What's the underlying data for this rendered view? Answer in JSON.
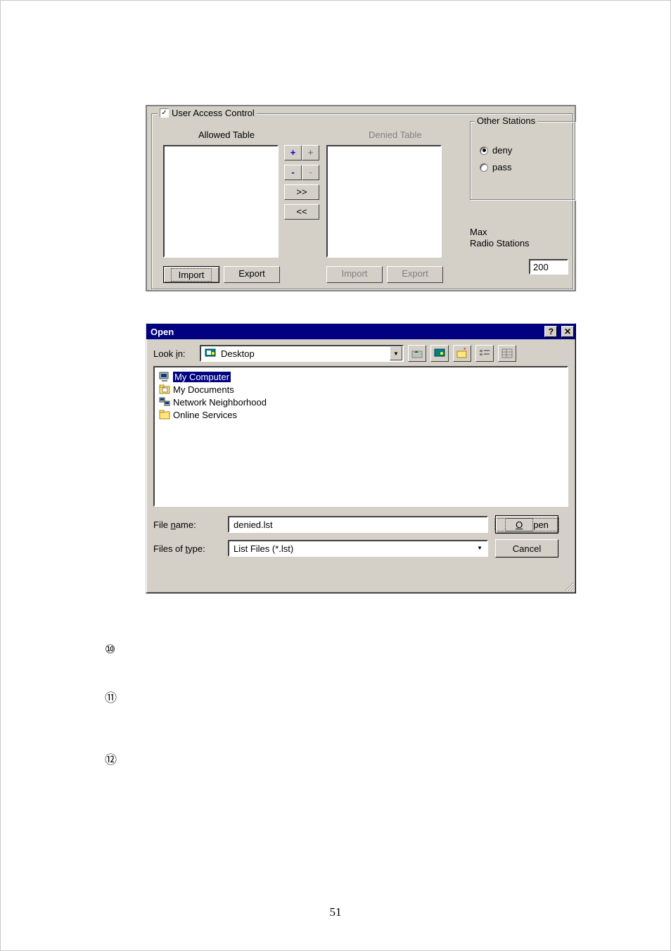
{
  "uac": {
    "title": "User Access Control",
    "checked": true,
    "allowed_label": "Allowed Table",
    "denied_label": "Denied Table",
    "btn_add": "+",
    "btn_add_dim": "+",
    "btn_del": "-",
    "btn_del_dim": "-",
    "btn_right": ">>",
    "btn_left": "<<",
    "import": "Import",
    "export": "Export",
    "import2": "Import",
    "export2": "Export",
    "other_title": "Other Stations",
    "deny": "deny",
    "pass": "pass",
    "radio_selected": "deny",
    "max_label1": "Max",
    "max_label2": "Radio Stations",
    "max_value": "200"
  },
  "open": {
    "title": "Open",
    "lookin_label": "Look in:",
    "lookin_underline_index": 5,
    "lookin_value": "Desktop",
    "files": [
      {
        "name": "My Computer",
        "icon": "computer"
      },
      {
        "name": "My Documents",
        "icon": "folder-docs"
      },
      {
        "name": "Network Neighborhood",
        "icon": "network"
      },
      {
        "name": "Online Services",
        "icon": "folder"
      }
    ],
    "selected_index": 0,
    "filename_label": "File name:",
    "filename_underline_index": 5,
    "filename_value": "denied.lst",
    "filetype_label": "Files of type:",
    "filetype_underline_index": 9,
    "filetype_value": "List Files (*.lst)",
    "open_btn": "Open",
    "open_underline_index": 0,
    "cancel_btn": "Cancel"
  },
  "circled": {
    "c10": "⑩",
    "c11": "⑪",
    "c12": "⑫"
  },
  "page_number": "51"
}
